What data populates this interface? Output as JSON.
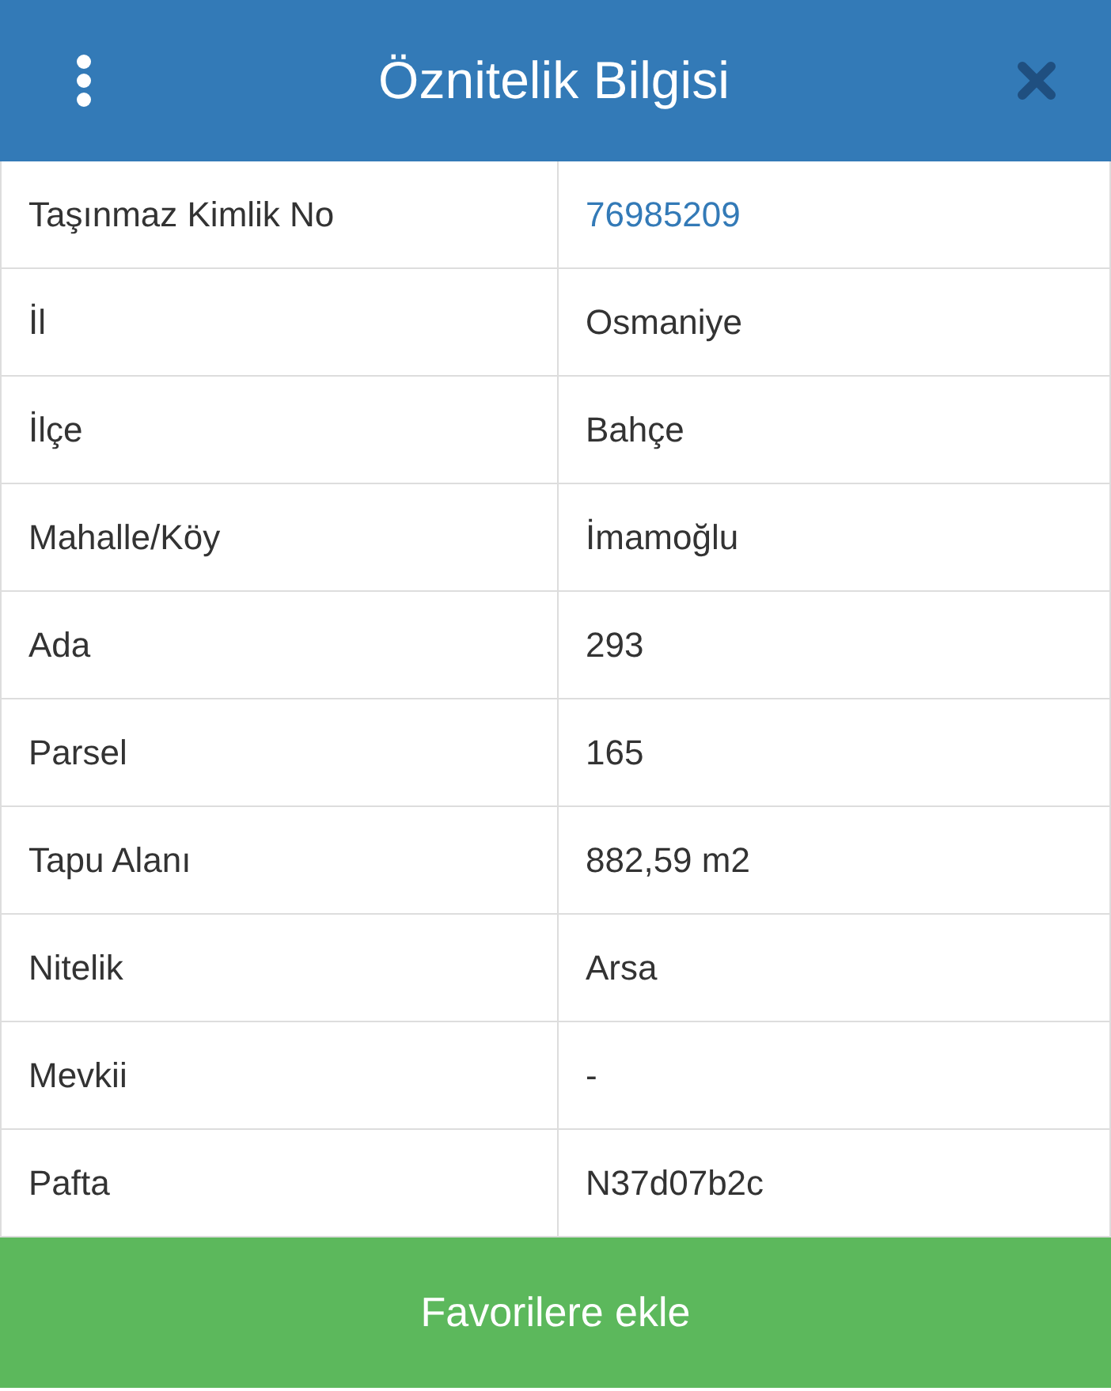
{
  "header": {
    "title": "Öznitelik Bilgisi"
  },
  "rows": [
    {
      "label": "Taşınmaz Kimlik No",
      "value": "76985209",
      "kind": "link"
    },
    {
      "label": "İl",
      "value": "Osmaniye",
      "kind": "text"
    },
    {
      "label": "İlçe",
      "value": "Bahçe",
      "kind": "text"
    },
    {
      "label": "Mahalle/Köy",
      "value": "İmamoğlu",
      "kind": "text"
    },
    {
      "label": "Ada",
      "value": "293",
      "kind": "text"
    },
    {
      "label": "Parsel",
      "value": "165",
      "kind": "text"
    },
    {
      "label": "Tapu Alanı",
      "value": "882,59 m2",
      "kind": "text"
    },
    {
      "label": "Nitelik",
      "value": "Arsa",
      "kind": "text"
    },
    {
      "label": "Mevkii",
      "value": "-",
      "kind": "text"
    },
    {
      "label": "Pafta",
      "value": "N37d07b2c",
      "kind": "text"
    }
  ],
  "button": {
    "label": "Favorilere ekle"
  }
}
